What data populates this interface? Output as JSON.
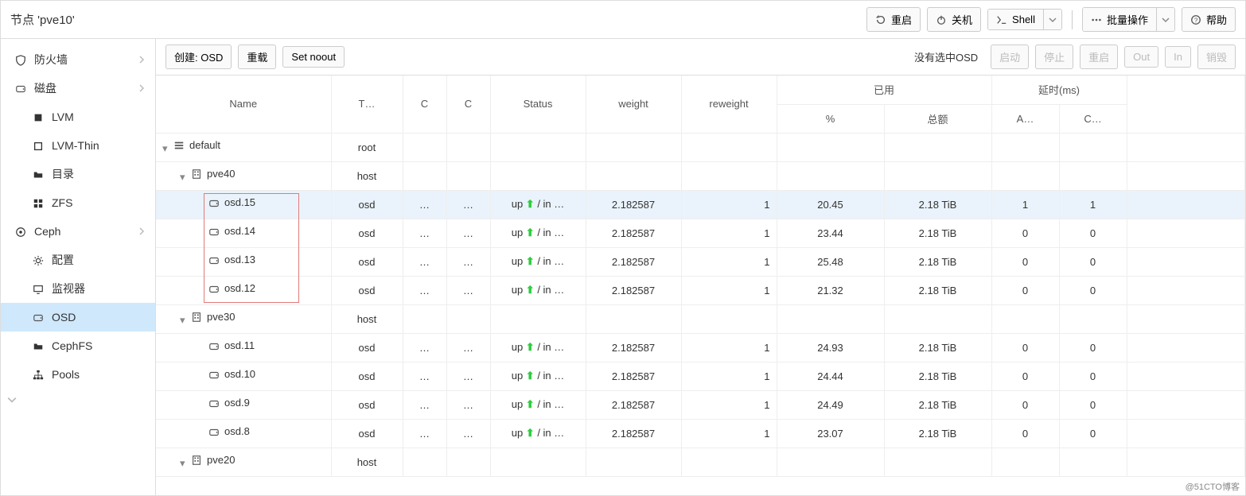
{
  "top": {
    "title": "节点 'pve10'",
    "reboot": "重启",
    "shutdown": "关机",
    "shell": "Shell",
    "bulk": "批量操作",
    "help": "帮助"
  },
  "sidebar": [
    {
      "key": "firewall",
      "label": "防火墙",
      "icon": "shield",
      "child": false,
      "expand": true
    },
    {
      "key": "disks",
      "label": "磁盘",
      "icon": "disk",
      "child": false,
      "expand": true
    },
    {
      "key": "lvm",
      "label": "LVM",
      "icon": "square-solid",
      "child": true
    },
    {
      "key": "lvm-thin",
      "label": "LVM-Thin",
      "icon": "square-outline",
      "child": true
    },
    {
      "key": "dir",
      "label": "目录",
      "icon": "folder",
      "child": true
    },
    {
      "key": "zfs",
      "label": "ZFS",
      "icon": "grid",
      "child": true
    },
    {
      "key": "ceph",
      "label": "Ceph",
      "icon": "ceph",
      "child": false,
      "expand": true
    },
    {
      "key": "cfg",
      "label": "配置",
      "icon": "gear",
      "child": true
    },
    {
      "key": "mon",
      "label": "监视器",
      "icon": "monitor",
      "child": true
    },
    {
      "key": "osd",
      "label": "OSD",
      "icon": "disk",
      "child": true,
      "selected": true
    },
    {
      "key": "cephfs",
      "label": "CephFS",
      "icon": "folder",
      "child": true
    },
    {
      "key": "pools",
      "label": "Pools",
      "icon": "sitemap",
      "child": true
    }
  ],
  "toolbar": {
    "create_osd": "创建: OSD",
    "reload": "重载",
    "set_noout": "Set noout",
    "status": "没有选中OSD",
    "start": "启动",
    "stop": "停止",
    "restart": "重启",
    "out": "Out",
    "in": "In",
    "destroy": "销毁"
  },
  "columns": {
    "name": "Name",
    "type": "T…",
    "c1": "C",
    "c2": "C",
    "status": "Status",
    "weight": "weight",
    "reweight": "reweight",
    "used_group": "已用",
    "latency_group": "延时(ms)",
    "pct": "%",
    "total": "总额",
    "a": "A…",
    "c": "C…"
  },
  "rows": [
    {
      "level": 0,
      "name": "default",
      "type": "root",
      "icon": "tree",
      "toggle": "open"
    },
    {
      "level": 1,
      "name": "pve40",
      "type": "host",
      "icon": "host",
      "toggle": "open"
    },
    {
      "level": 2,
      "name": "osd.15",
      "type": "osd",
      "icon": "disk",
      "c1": "…",
      "c2": "…",
      "status": "up ● / in …",
      "weight": "2.182587",
      "reweight": "1",
      "pct": "20.45",
      "total": "2.18 TiB",
      "a": "1",
      "c": "1",
      "sel": true,
      "hl": true
    },
    {
      "level": 2,
      "name": "osd.14",
      "type": "osd",
      "icon": "disk",
      "c1": "…",
      "c2": "…",
      "status": "up ● / in …",
      "weight": "2.182587",
      "reweight": "1",
      "pct": "23.44",
      "total": "2.18 TiB",
      "a": "0",
      "c": "0",
      "hl": true
    },
    {
      "level": 2,
      "name": "osd.13",
      "type": "osd",
      "icon": "disk",
      "c1": "…",
      "c2": "…",
      "status": "up ● / in …",
      "weight": "2.182587",
      "reweight": "1",
      "pct": "25.48",
      "total": "2.18 TiB",
      "a": "0",
      "c": "0",
      "hl": true
    },
    {
      "level": 2,
      "name": "osd.12",
      "type": "osd",
      "icon": "disk",
      "c1": "…",
      "c2": "…",
      "status": "up ● / in …",
      "weight": "2.182587",
      "reweight": "1",
      "pct": "21.32",
      "total": "2.18 TiB",
      "a": "0",
      "c": "0",
      "hl": true
    },
    {
      "level": 1,
      "name": "pve30",
      "type": "host",
      "icon": "host",
      "toggle": "open"
    },
    {
      "level": 2,
      "name": "osd.11",
      "type": "osd",
      "icon": "disk",
      "c1": "…",
      "c2": "…",
      "status": "up ● / in …",
      "weight": "2.182587",
      "reweight": "1",
      "pct": "24.93",
      "total": "2.18 TiB",
      "a": "0",
      "c": "0"
    },
    {
      "level": 2,
      "name": "osd.10",
      "type": "osd",
      "icon": "disk",
      "c1": "…",
      "c2": "…",
      "status": "up ● / in …",
      "weight": "2.182587",
      "reweight": "1",
      "pct": "24.44",
      "total": "2.18 TiB",
      "a": "0",
      "c": "0"
    },
    {
      "level": 2,
      "name": "osd.9",
      "type": "osd",
      "icon": "disk",
      "c1": "…",
      "c2": "…",
      "status": "up ● / in …",
      "weight": "2.182587",
      "reweight": "1",
      "pct": "24.49",
      "total": "2.18 TiB",
      "a": "0",
      "c": "0"
    },
    {
      "level": 2,
      "name": "osd.8",
      "type": "osd",
      "icon": "disk",
      "c1": "…",
      "c2": "…",
      "status": "up ● / in …",
      "weight": "2.182587",
      "reweight": "1",
      "pct": "23.07",
      "total": "2.18 TiB",
      "a": "0",
      "c": "0"
    },
    {
      "level": 1,
      "name": "pve20",
      "type": "host",
      "icon": "host",
      "toggle": "open"
    }
  ],
  "watermark": "@51CTO博客"
}
